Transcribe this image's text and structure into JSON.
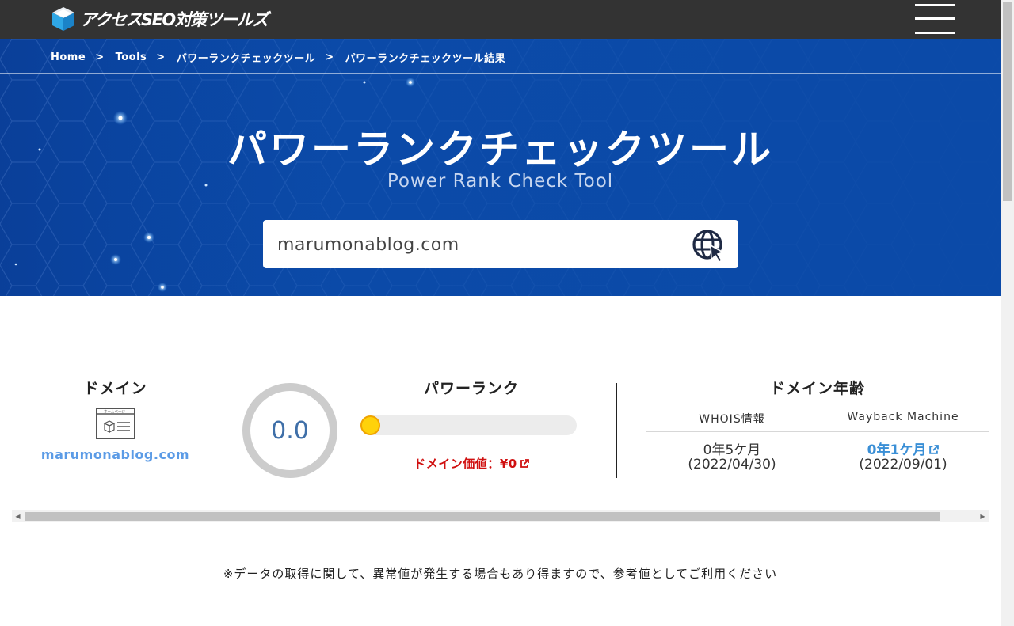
{
  "navbar": {
    "logo_text": "アクセスSEO対策ツールズ",
    "menu_icon": "hamburger-icon"
  },
  "breadcrumb": {
    "items": [
      "Home",
      "Tools",
      "パワーランクチェックツール",
      "パワーランクチェックツール結果"
    ],
    "separator": ">"
  },
  "hero": {
    "title": "パワーランクチェックツール",
    "subtitle": "Power Rank Check Tool"
  },
  "search": {
    "value": "marumonablog.com",
    "icon": "globe-cursor-icon"
  },
  "results": {
    "domain": {
      "title": "ドメイン",
      "icon": "homepage-icon",
      "icon_label": "ホームページ",
      "value": "marumonablog.com"
    },
    "power_rank": {
      "score": "0.0",
      "title": "パワーランク",
      "level": 0,
      "domain_value_label": "ドメイン価値：",
      "domain_value": "¥0"
    },
    "domain_age": {
      "title": "ドメイン年齢",
      "whois": {
        "label": "WHOIS情報",
        "age": "0年5ケ月",
        "date": "(2022/04/30)"
      },
      "wayback": {
        "label": "Wayback Machine",
        "age": "0年1ケ月",
        "date": "(2022/09/01)"
      }
    }
  },
  "notice": "※データの取得に関して、異常値が発生する場合もあり得ますので、参考値としてご利用ください",
  "colors": {
    "navbar": "#333333",
    "hero": "#0b4aa8",
    "domain_link": "#5b9be6",
    "value_red": "#d01010",
    "wayback_link": "#3a8fd6",
    "knob": "#ffd20a"
  }
}
